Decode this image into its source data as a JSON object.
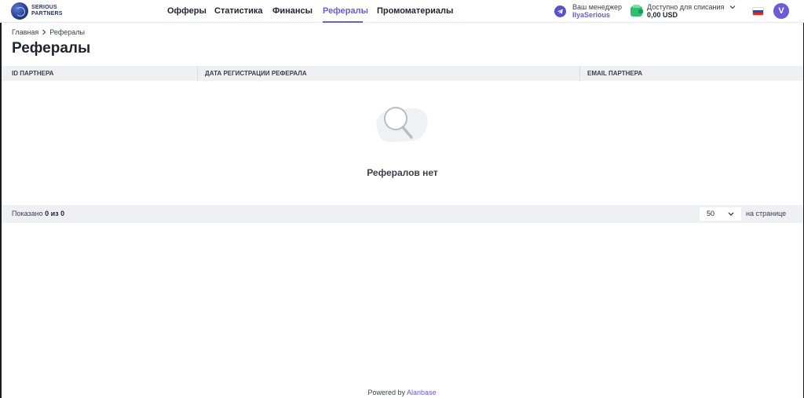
{
  "brand": {
    "line1": "SERIOUS",
    "line2": "PARTNERS"
  },
  "nav": {
    "items": [
      {
        "label": "Офферы"
      },
      {
        "label": "Статистика"
      },
      {
        "label": "Финансы"
      },
      {
        "label": "Рефералы"
      },
      {
        "label": "Промоматериалы"
      }
    ],
    "active": "Рефералы"
  },
  "manager": {
    "label": "Ваш менеджер",
    "name": "IlyaSerious"
  },
  "balance": {
    "label": "Доступно для списания",
    "value": "0,00  USD"
  },
  "user": {
    "avatar_letter": "V",
    "language_flag": "ru"
  },
  "breadcrumb": {
    "home": "Главная",
    "current": "Рефералы"
  },
  "page": {
    "title": "Рефералы"
  },
  "table": {
    "columns": [
      "ID партнера",
      "Дата регистрации реферала",
      "Email партнера"
    ],
    "empty_text": "Рефералов нет"
  },
  "pagination": {
    "shown_prefix": "Показано",
    "shown_count": "0 из 0",
    "per_page_value": "50",
    "per_page_label": "на странице"
  },
  "footer": {
    "powered_by": "Powered by",
    "vendor": "Alanbase"
  },
  "colors": {
    "accent": "#6b5bd6",
    "wallet": "#2fbf6f",
    "table_bg": "#eef0f4"
  }
}
